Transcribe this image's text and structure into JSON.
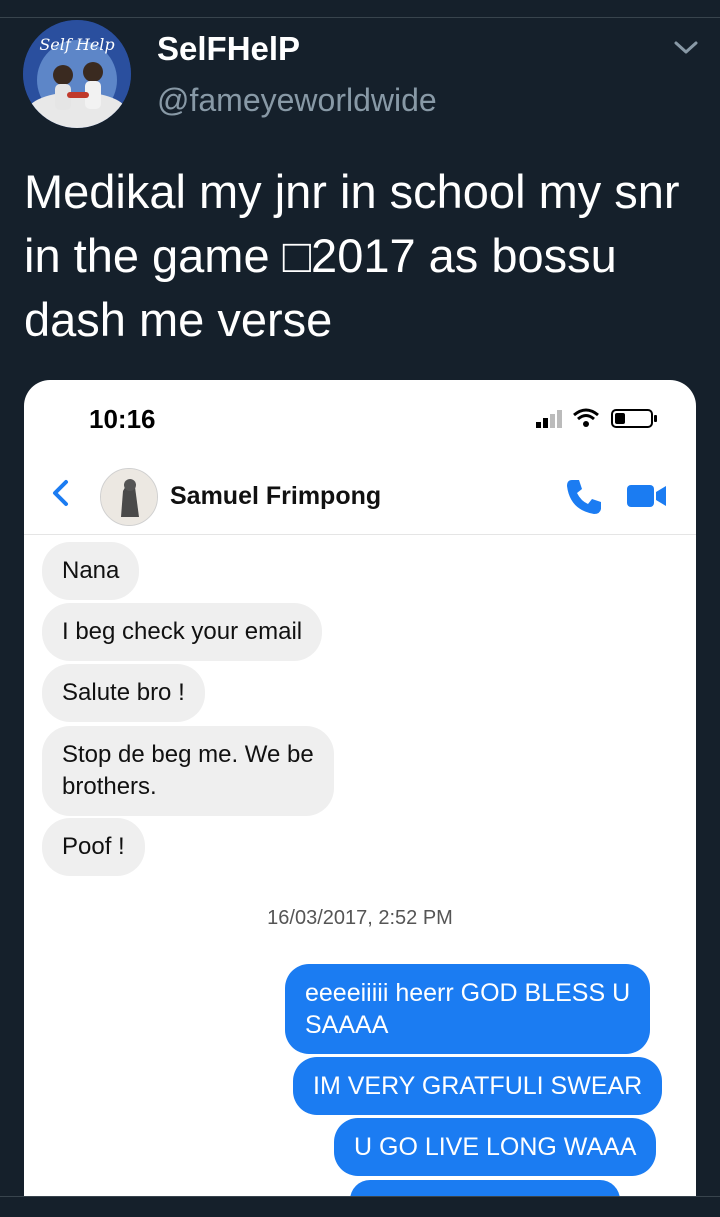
{
  "tweet": {
    "display_name": "SelFHelP",
    "handle": "@fameyeworldwide",
    "text": "Medikal my jnr in school my snr in the game □2017 as bossu dash me verse",
    "avatar_text": "Self Help"
  },
  "screenshot": {
    "status_time": "10:16",
    "contact_name": "Samuel Frimpong",
    "incoming_messages": [
      "Nana",
      "I beg check your email",
      "Salute bro !",
      "Stop de beg me. We be\nbrothers.",
      "Poof !"
    ],
    "timestamp": "16/03/2017, 2:52 PM",
    "outgoing_messages": [
      "eeeeiiiii heerr GOD BLESS U\nSAAAA",
      "IM VERY GRATFULI SWEAR",
      "U GO LIVE LONG WAAA"
    ]
  },
  "colors": {
    "background": "#15202b",
    "secondary_text": "#8899a6",
    "messenger_blue": "#1b7cf2",
    "incoming_bubble": "#efefef"
  },
  "icons": [
    "chevron-down-icon",
    "signal-icon",
    "wifi-icon",
    "battery-icon",
    "back-chevron-icon",
    "phone-icon",
    "video-icon"
  ]
}
